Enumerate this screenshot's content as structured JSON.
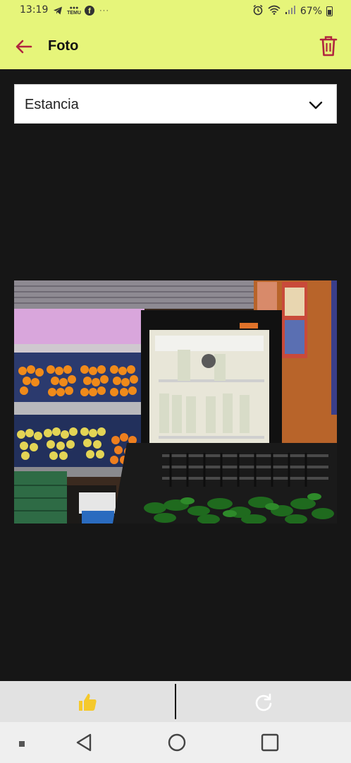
{
  "status_bar": {
    "time": "13:19",
    "battery": "67%",
    "left_icons": [
      "telegram-icon",
      "temu-icon",
      "facebook-icon",
      "more-dots-icon"
    ],
    "right_icons": [
      "alarm-icon",
      "wifi-icon",
      "signal-icon",
      "battery-icon"
    ],
    "temu_text": "TEMU"
  },
  "app_bar": {
    "title": "Foto",
    "back_icon": "arrow-left-icon",
    "delete_icon": "trash-icon"
  },
  "dropdown": {
    "selected": "Estancia",
    "icon": "chevron-down-icon"
  },
  "photo": {
    "subject": "store-interior-photo"
  },
  "action_bar": {
    "left_icon": "thumbs-up-icon",
    "right_icon": "rotate-icon"
  },
  "nav_bar": {
    "items": [
      "nav-dot",
      "back",
      "home",
      "recents"
    ]
  },
  "colors": {
    "accent": "#e6f57a",
    "icon_red": "#b0253f",
    "background": "#161616",
    "thumb_yellow": "#f5c92b"
  }
}
